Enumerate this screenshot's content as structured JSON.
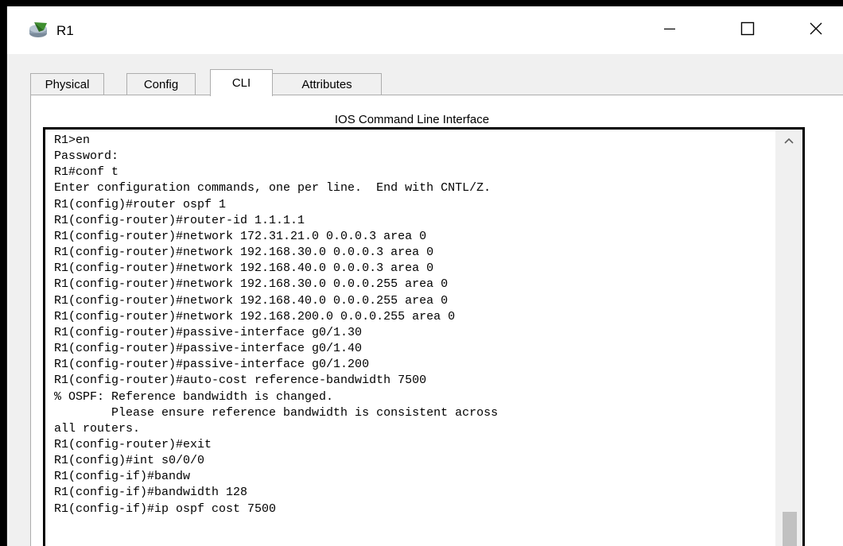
{
  "window": {
    "title": "R1",
    "icon": "router-icon",
    "controls": [
      "minimize-icon",
      "maximize-icon",
      "close-icon"
    ]
  },
  "tabs": [
    {
      "label": "Physical",
      "active": false
    },
    {
      "label": "Config",
      "active": false
    },
    {
      "label": "CLI",
      "active": true
    },
    {
      "label": "Attributes",
      "active": false
    }
  ],
  "panel": {
    "title": "IOS Command Line Interface"
  },
  "terminal": {
    "lines": [
      "R1>en",
      "Password:",
      "R1#conf t",
      "Enter configuration commands, one per line.  End with CNTL/Z.",
      "R1(config)#router ospf 1",
      "R1(config-router)#router-id 1.1.1.1",
      "R1(config-router)#network 172.31.21.0 0.0.0.3 area 0",
      "R1(config-router)#network 192.168.30.0 0.0.0.3 area 0",
      "R1(config-router)#network 192.168.40.0 0.0.0.3 area 0",
      "R1(config-router)#network 192.168.30.0 0.0.0.255 area 0",
      "R1(config-router)#network 192.168.40.0 0.0.0.255 area 0",
      "R1(config-router)#network 192.168.200.0 0.0.0.255 area 0",
      "R1(config-router)#passive-interface g0/1.30",
      "R1(config-router)#passive-interface g0/1.40",
      "R1(config-router)#passive-interface g0/1.200",
      "R1(config-router)#auto-cost reference-bandwidth 7500",
      "% OSPF: Reference bandwidth is changed.",
      "        Please ensure reference bandwidth is consistent across",
      "all routers.",
      "R1(config-router)#exit",
      "R1(config)#int s0/0/0",
      "R1(config-if)#bandw",
      "R1(config-if)#bandwidth 128",
      "R1(config-if)#ip ospf cost 7500"
    ]
  },
  "colors": {
    "window_bg": "#f0f0f0",
    "titlebar_bg": "#ffffff",
    "terminal_border": "#000000",
    "scroll_thumb": "#c1c1c1"
  }
}
